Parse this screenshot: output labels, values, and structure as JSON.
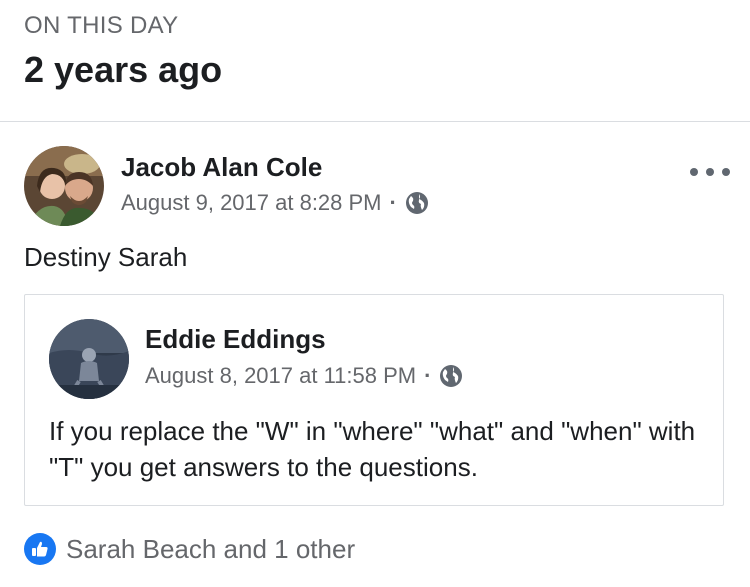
{
  "on_this_day": {
    "kicker": "ON THIS DAY",
    "title": "2 years ago"
  },
  "post": {
    "author": "Jacob Alan Cole",
    "timestamp": "August 9, 2017 at 8:28 PM",
    "separator": "·",
    "privacy_icon": "globe-icon",
    "menu_icon": "more-options-icon",
    "text": "Destiny Sarah",
    "shared": {
      "author": "Eddie Eddings",
      "timestamp": "August 8, 2017 at 11:58 PM",
      "separator": "·",
      "privacy_icon": "globe-icon",
      "text": "If you replace the \"W\" in \"where\" \"what\" and \"when\" with \"T\" you get answers to the questions."
    },
    "reactions": {
      "icon": "like-icon",
      "summary": "Sarah Beach and 1 other"
    }
  },
  "colors": {
    "text_primary": "#1c1e21",
    "text_secondary": "#65676b",
    "like_blue": "#1877f2",
    "border": "#dadde1"
  }
}
